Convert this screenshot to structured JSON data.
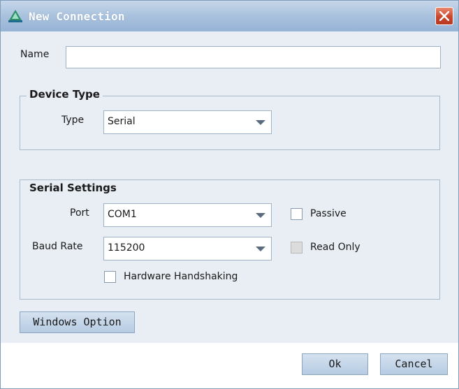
{
  "window": {
    "title": "New Connection",
    "close_glyph": "close-icon"
  },
  "name_field": {
    "label": "Name",
    "value": ""
  },
  "device_type": {
    "title": "Device Type",
    "type_label": "Type",
    "type_value": "Serial"
  },
  "serial_settings": {
    "title": "Serial Settings",
    "port_label": "Port",
    "port_value": "COM1",
    "passive_label": "Passive",
    "passive_checked": false,
    "baud_label": "Baud Rate",
    "baud_value": "115200",
    "read_only_label": "Read Only",
    "read_only_checked": false,
    "read_only_enabled": false,
    "handshaking_label": "Hardware Handshaking",
    "handshaking_checked": false
  },
  "buttons": {
    "windows_option": "Windows Option",
    "ok": "Ok",
    "cancel": "Cancel"
  },
  "colors": {
    "titlebar": "#a6bfdc",
    "client_background": "#e8eef4",
    "close_button": "#c9442a"
  }
}
